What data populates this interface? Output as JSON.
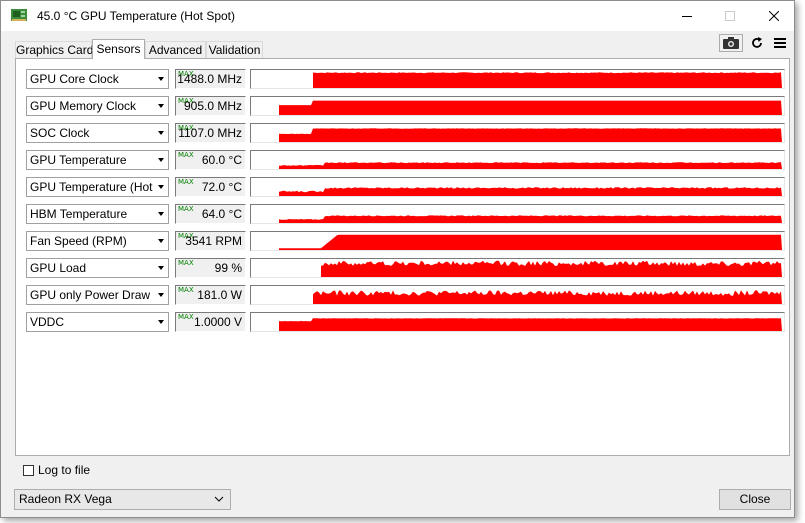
{
  "window": {
    "title": "45.0 °C GPU Temperature (Hot Spot)"
  },
  "tabs": [
    {
      "label": "Graphics Card"
    },
    {
      "label": "Sensors"
    },
    {
      "label": "Advanced"
    },
    {
      "label": "Validation"
    }
  ],
  "active_tab": "Sensors",
  "toolbar_icons": [
    "camera-icon",
    "refresh-icon",
    "menu-icon"
  ],
  "max_badge": "MAX",
  "graph_color": "#ff0000",
  "sensors": [
    {
      "name": "GPU Core Clock",
      "value": "1488.0 MHz"
    },
    {
      "name": "GPU Memory Clock",
      "value": "905.0 MHz"
    },
    {
      "name": "SOC Clock",
      "value": "1107.0 MHz"
    },
    {
      "name": "GPU Temperature",
      "value": "60.0 °C"
    },
    {
      "name": "GPU Temperature (Hot Spot)",
      "value": "72.0 °C"
    },
    {
      "name": "HBM Temperature",
      "value": "64.0 °C"
    },
    {
      "name": "Fan Speed (RPM)",
      "value": "3541 RPM"
    },
    {
      "name": "GPU Load",
      "value": "99 %"
    },
    {
      "name": "GPU only Power Draw",
      "value": "181.0 W"
    },
    {
      "name": "VDDC",
      "value": "1.0000 V"
    }
  ],
  "footer": {
    "log_label": "Log to file",
    "log_checked": false,
    "device": "Radeon RX Vega",
    "close_label": "Close"
  }
}
